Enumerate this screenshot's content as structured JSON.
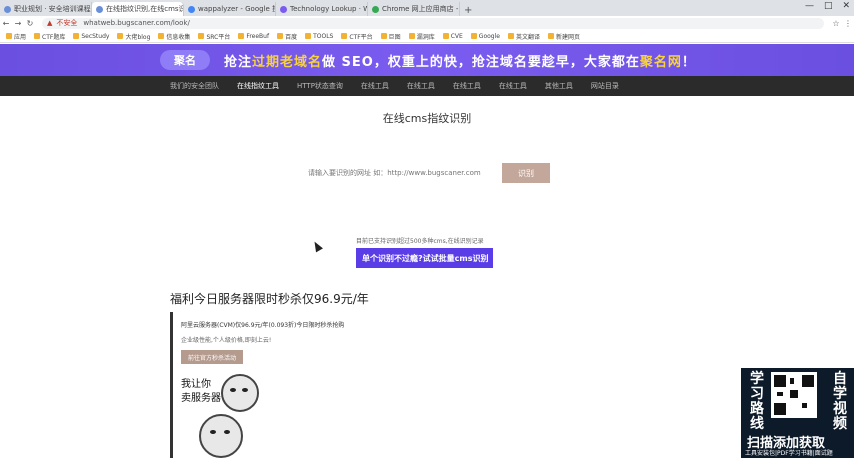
{
  "browser": {
    "tabs": [
      {
        "label": "职业规划 · 安全培训课程"
      },
      {
        "label": "在线指纹识别,在线cms识别"
      },
      {
        "label": "wappalyzer - Google 搜索"
      },
      {
        "label": "Technology Lookup · Wappal"
      },
      {
        "label": "Chrome 网上应用商店 - wappal"
      }
    ],
    "new_tab": "+",
    "window_controls": [
      "—",
      "□",
      "✕"
    ],
    "security_label": "不安全",
    "url": "whatweb.bugscaner.com/look/",
    "bookmarks": [
      "应用",
      "CTF题库",
      "SecStudy",
      "大佬blog",
      "信息收集",
      "SRC平台",
      "FreeBuf",
      "百度",
      "TOOLS",
      "CTF平台",
      "巨图",
      "漏洞库",
      "CVE",
      "Google",
      "英文翻译",
      "新建网页"
    ]
  },
  "banner": {
    "logo": "聚名",
    "slogan_prefix": "抢注",
    "slogan_highlight": "过期老域名",
    "slogan_rest": "做 SEO，权重上的快，抢注域名要趁早，大家都在",
    "slogan_highlight2": "聚名网",
    "slogan_end": "！"
  },
  "nav": {
    "items": [
      "我们的安全团队",
      "在线指纹工具",
      "HTTP状态查询",
      "在线工具",
      "在线工具",
      "在线工具",
      "在线工具",
      "其他工具",
      "网站目录"
    ]
  },
  "main": {
    "title": "在线cms指纹识别",
    "search_placeholder": "请输入要识别的网址 如：http://www.bugscaner.com",
    "search_button": "识别",
    "notice": "目前已支持识别超过500多种cms,在线识别记录",
    "batch_button": "单个识别不过瘾?试试批量cms识别"
  },
  "promo": {
    "title": "福利今日服务器限时秒杀仅96.9元/年",
    "line1": "阿里云服务器(CVM)仅96.9元/年(0.093折)今日限时秒杀抢购",
    "line2": "企业级性能,个人级价格,即刻上云!",
    "button": "前往官方秒杀活动",
    "meme_text": "我让你\n卖服务器"
  },
  "qr_ad": {
    "left_text": "学习路线",
    "right_text": "自学视频",
    "cta": "扫描添加获取",
    "sub": "工具安装包|PDF学习书籍|面试题"
  }
}
